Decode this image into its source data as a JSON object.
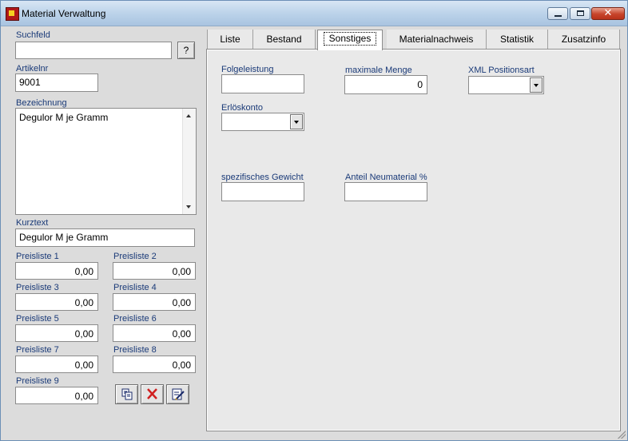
{
  "window": {
    "title": "Material Verwaltung",
    "icon": "app-logo-icon"
  },
  "left": {
    "suchfeld_label": "Suchfeld",
    "suchfeld_value": "",
    "help_button": "?",
    "artikelnr_label": "Artikelnr",
    "artikelnr_value": "9001",
    "bezeichnung_label": "Bezeichnung",
    "bezeichnung_value": "Degulor M je Gramm",
    "kurztext_label": "Kurztext",
    "kurztext_value": "Degulor M je Gramm",
    "preislisten": [
      {
        "label": "Preisliste 1",
        "value": "0,00"
      },
      {
        "label": "Preisliste 2",
        "value": "0,00"
      },
      {
        "label": "Preisliste 3",
        "value": "0,00"
      },
      {
        "label": "Preisliste 4",
        "value": "0,00"
      },
      {
        "label": "Preisliste 5",
        "value": "0,00"
      },
      {
        "label": "Preisliste 6",
        "value": "0,00"
      },
      {
        "label": "Preisliste 7",
        "value": "0,00"
      },
      {
        "label": "Preisliste 8",
        "value": "0,00"
      },
      {
        "label": "Preisliste 9",
        "value": "0,00"
      }
    ],
    "action_icons": [
      "copy-icon",
      "delete-icon",
      "edit-icon"
    ]
  },
  "tabs": [
    {
      "label": "Liste"
    },
    {
      "label": "Bestand"
    },
    {
      "label": "Sonstiges",
      "active": true
    },
    {
      "label": "Materialnachweis"
    },
    {
      "label": "Statistik"
    },
    {
      "label": "Zusatzinfo"
    }
  ],
  "sonstiges": {
    "folgeleistung_label": "Folgeleistung",
    "folgeleistung_value": "",
    "max_menge_label": "maximale Menge",
    "max_menge_value": "0",
    "xml_label": "XML Positionsart",
    "xml_value": "",
    "erloeskonto_label": "Erlöskonto",
    "erloeskonto_value": "",
    "gewicht_label": "spezifisches Gewicht",
    "gewicht_value": "",
    "neumaterial_label": "Anteil Neumaterial %",
    "neumaterial_value": ""
  },
  "colors": {
    "label_blue": "#1a3a78",
    "background": "#dcdcdc",
    "title_bar": "#bcd3ea",
    "delete_red": "#d02020"
  }
}
